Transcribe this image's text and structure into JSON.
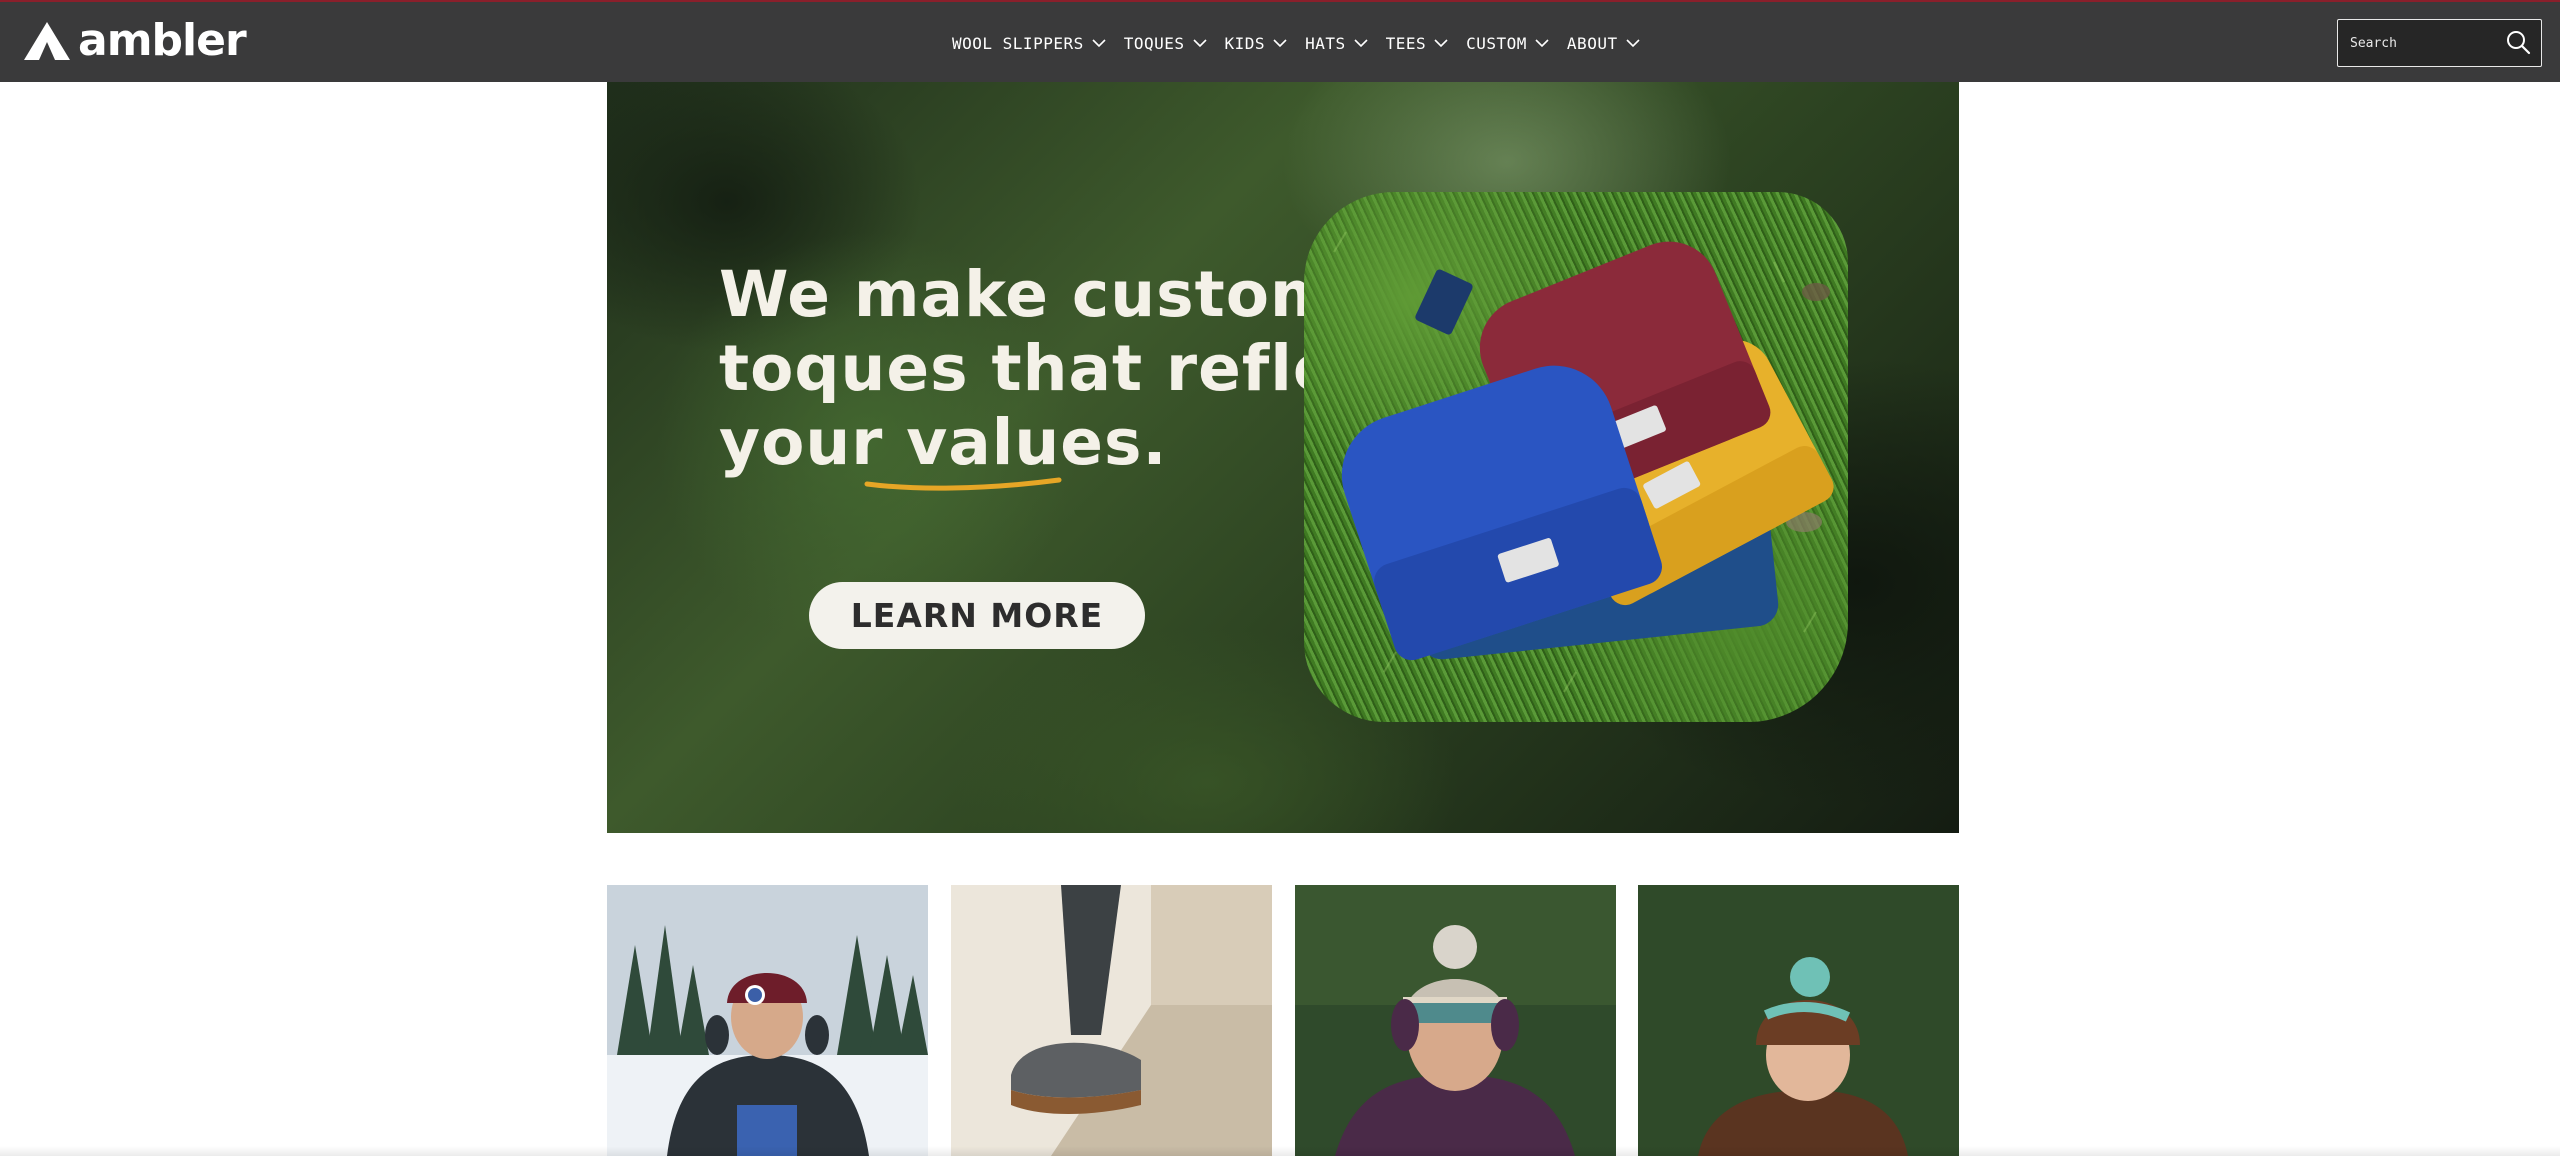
{
  "brand": {
    "name": "ambler",
    "icon": "ambler-a-logo-icon"
  },
  "nav": {
    "items": [
      {
        "label": "WOOL SLIPPERS"
      },
      {
        "label": "TOQUES"
      },
      {
        "label": "KIDS"
      },
      {
        "label": "HATS"
      },
      {
        "label": "TEES"
      },
      {
        "label": "CUSTOM"
      },
      {
        "label": "ABOUT"
      }
    ],
    "dropdown_icon": "chevron-down-icon"
  },
  "search": {
    "placeholder": "Search",
    "value": "",
    "icon": "search-icon"
  },
  "hero": {
    "headline_lines": [
      "We make custom",
      "toques that reflect",
      "your values."
    ],
    "cta_label": "LEARN MORE",
    "image": "stack of knit toques on grass (red, yellow, blue, navy)"
  },
  "tiles": [
    {
      "image": "woman-in-maroon-toque-snow"
    },
    {
      "image": "wool-slipper-on-step"
    },
    {
      "image": "woman-in-pom-pom-toque"
    },
    {
      "image": "child-in-brown-pom-pom-hat"
    }
  ],
  "colors": {
    "header_bg": "#3a3a3b",
    "header_accent": "#8a1f2b",
    "headline_text": "#f4f1e8",
    "underline_accent": "#e6a626",
    "cta_bg": "#f3f2ec",
    "toque_red": "#8b2a3a",
    "toque_yellow": "#e7b12b",
    "toque_blue": "#2a55c2",
    "toque_navy": "#1f4e8a"
  }
}
